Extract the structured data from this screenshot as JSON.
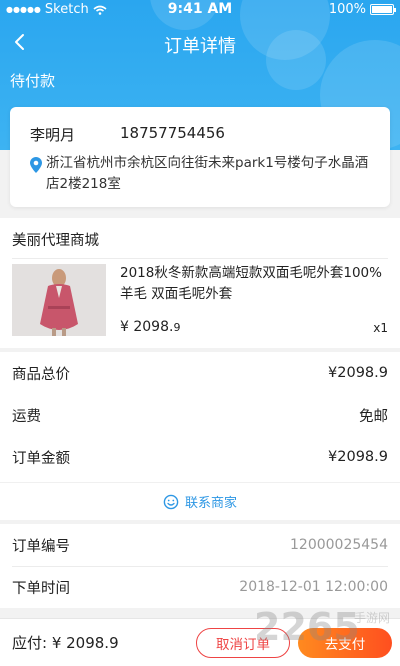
{
  "status_bar": {
    "carrier": "Sketch",
    "time": "9:41 AM",
    "battery": "100%"
  },
  "nav": {
    "title": "订单详情"
  },
  "order_status": "待付款",
  "address": {
    "name": "李明月",
    "phone": "18757754456",
    "detail": "浙江省杭州市余杭区向往街未来park1号楼句子水晶酒店2楼218室"
  },
  "shop": {
    "name": "美丽代理商城",
    "product": {
      "name": "2018秋冬新款高端短款双面毛呢外套100%羊毛 双面毛呢外套",
      "price_main": "¥ 2098.",
      "price_decimal": "9",
      "quantity": "x1"
    }
  },
  "summary": {
    "rows": [
      {
        "label": "商品总价",
        "value": "¥2098.9"
      },
      {
        "label": "运费",
        "value": "免邮"
      },
      {
        "label": "订单金额",
        "value": "¥2098.9"
      }
    ],
    "contact_label": "联系商家"
  },
  "info": {
    "rows": [
      {
        "label": "订单编号",
        "value": "12000025454"
      },
      {
        "label": "下单时间",
        "value": "2018-12-01 12:00:00"
      }
    ]
  },
  "bottom": {
    "payable": "应付: ¥ 2098.9",
    "cancel_label": "取消订单",
    "pay_label": "去支付"
  },
  "colors": {
    "header_blue": "#2aa6ef",
    "cancel_red": "#ee4444",
    "pay_orange": "#ff6a1f",
    "link_blue": "#2d97e4"
  }
}
